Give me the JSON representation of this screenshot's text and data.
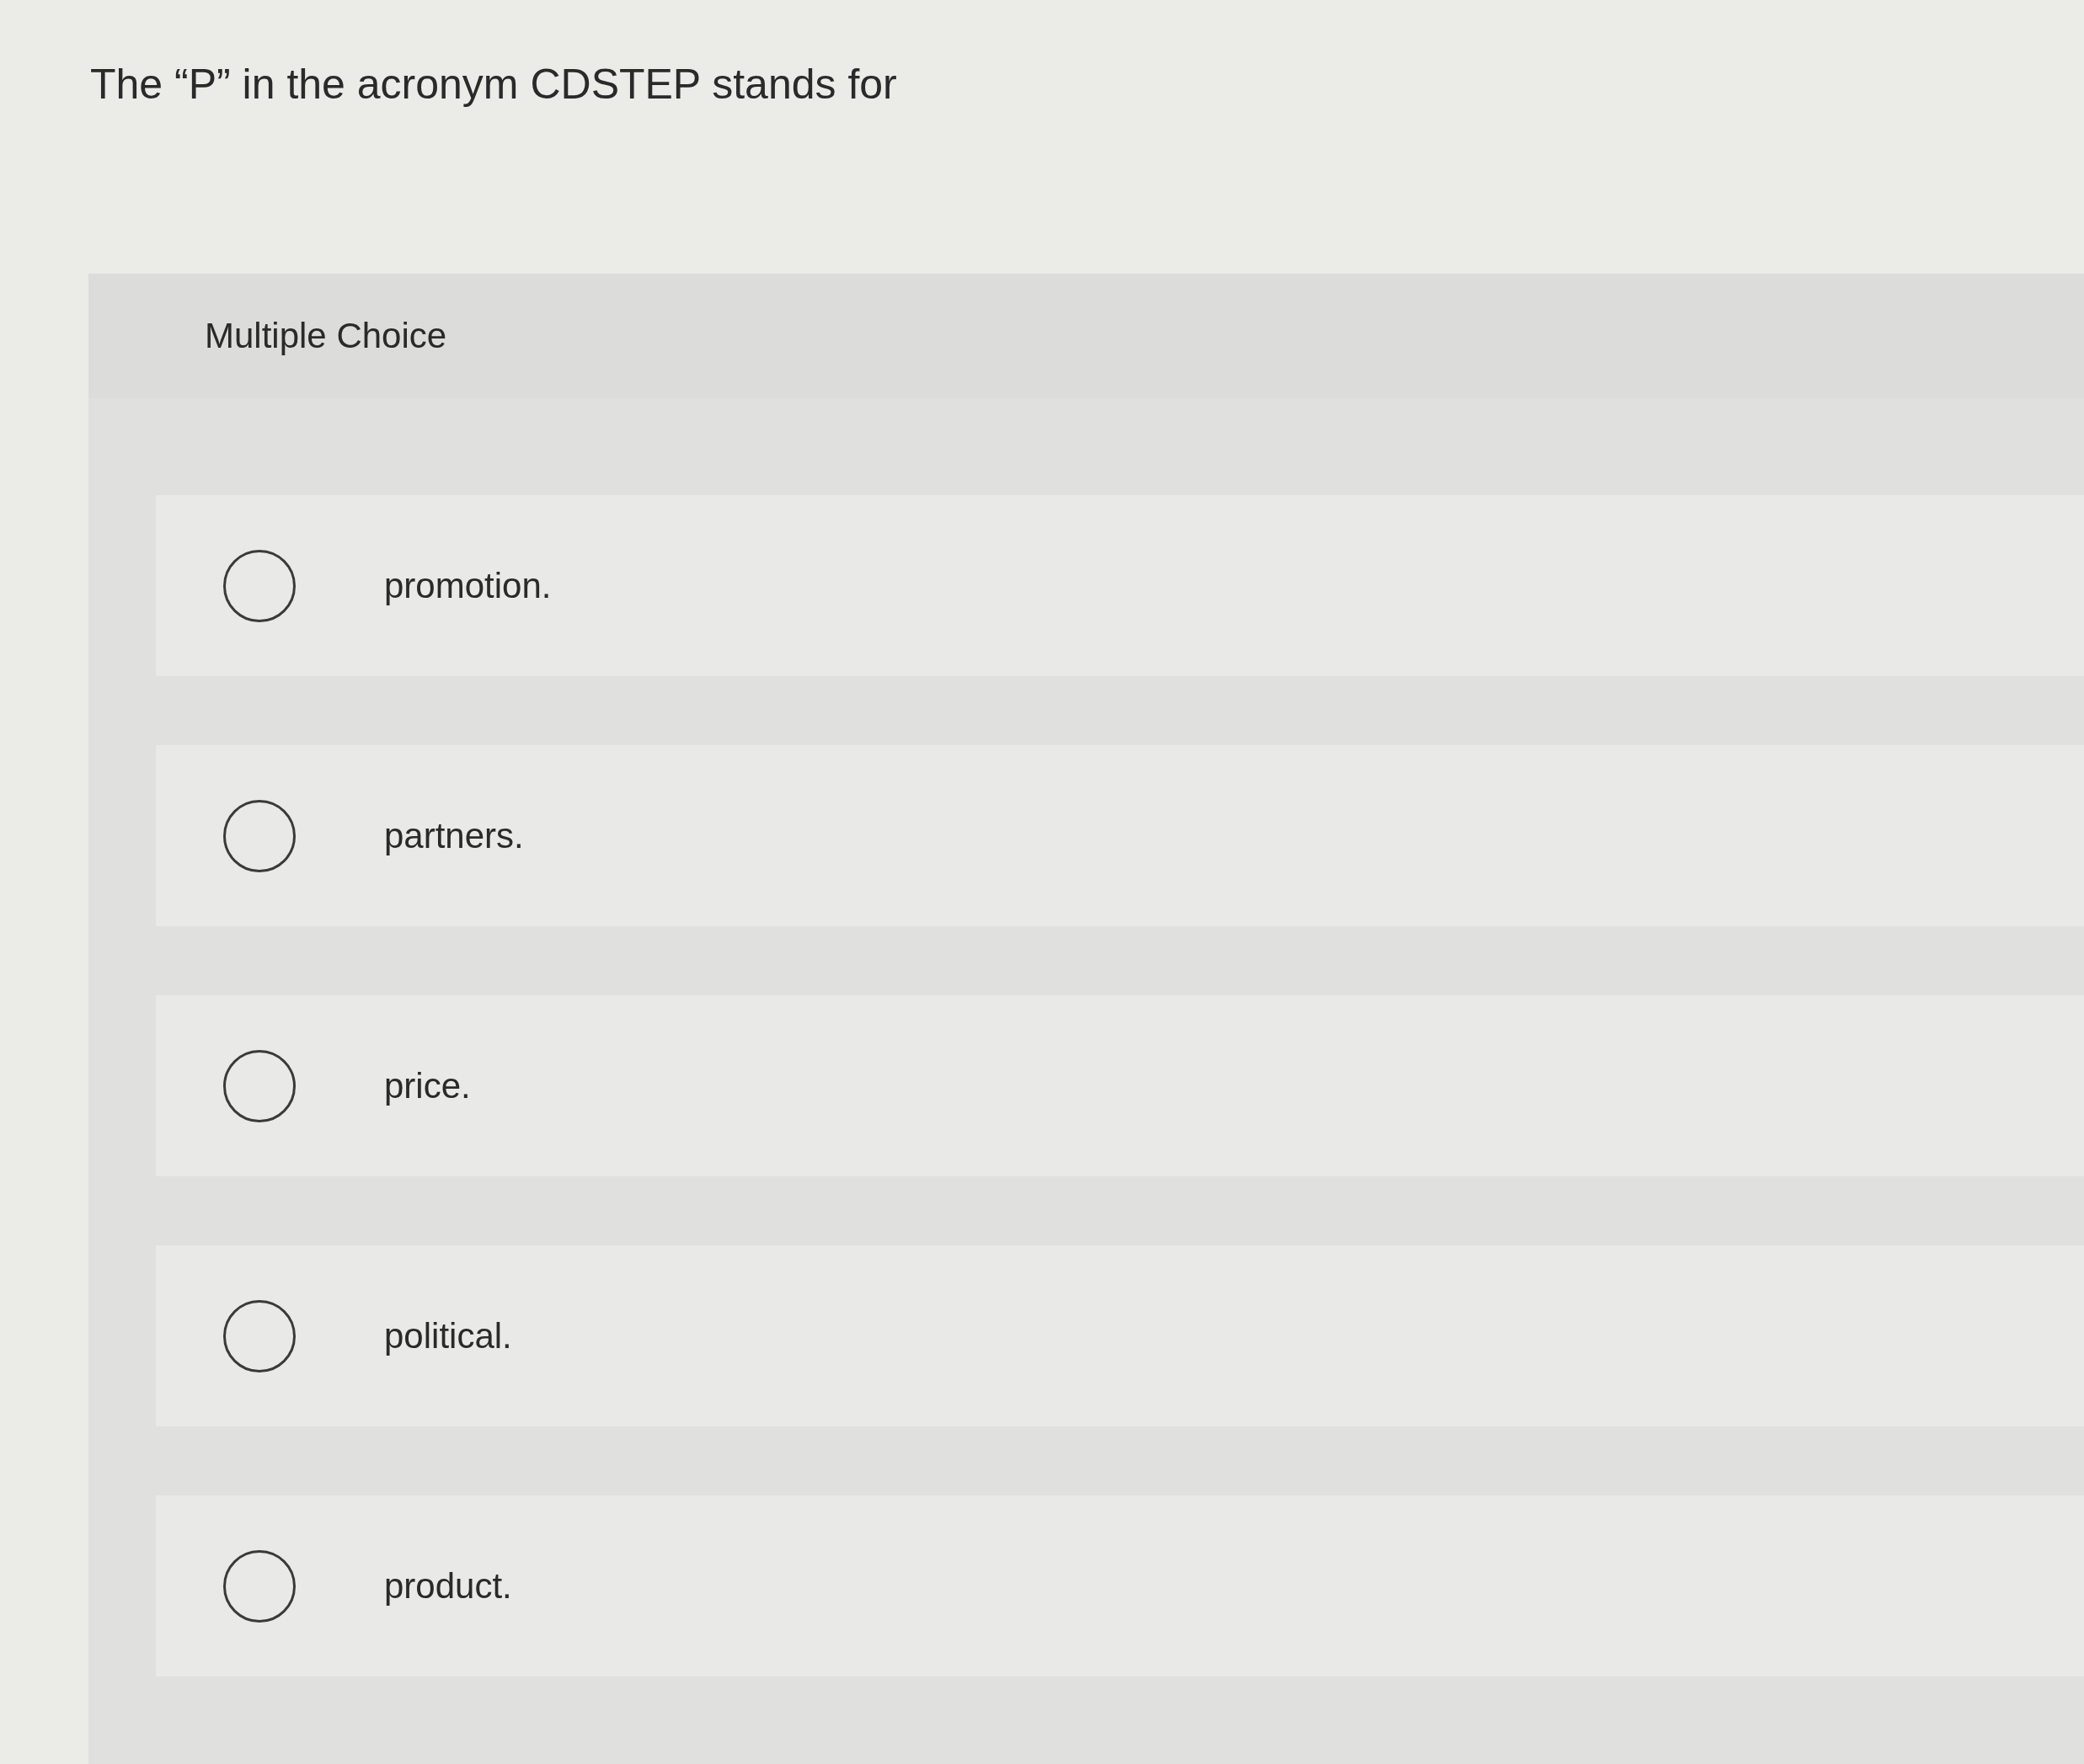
{
  "question": "The “P” in the acronym CDSTEP stands for",
  "panel_title": "Multiple Choice",
  "options": [
    {
      "label": "promotion.",
      "selected": false
    },
    {
      "label": "partners.",
      "selected": false
    },
    {
      "label": "price.",
      "selected": false
    },
    {
      "label": "political.",
      "selected": false
    },
    {
      "label": "product.",
      "selected": false
    }
  ]
}
